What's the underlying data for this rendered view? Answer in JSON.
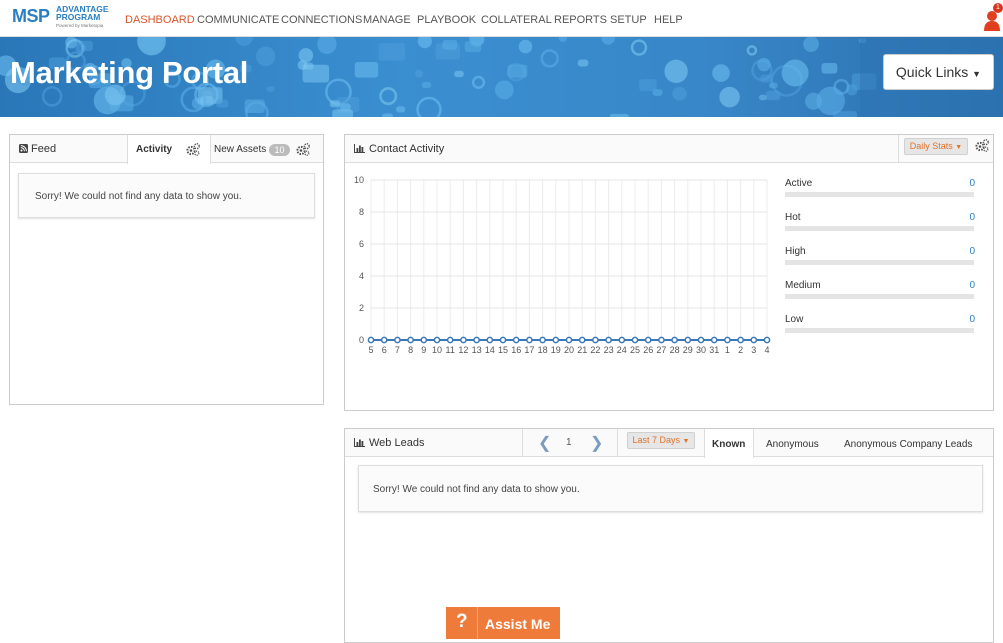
{
  "nav": {
    "logo": {
      "line1": "MSP",
      "line2": "ADVANTAGE",
      "line3": "PROGRAM",
      "powered": "Powered by Marketopia"
    },
    "links": [
      "DASHBOARD",
      "COMMUNICATE",
      "CONNECTIONS",
      "MANAGE",
      "PLAYBOOK",
      "COLLATERAL",
      "REPORTS",
      "SETUP",
      "HELP"
    ],
    "active": "DASHBOARD",
    "notification_count": "1"
  },
  "banner": {
    "title": "Marketing Portal",
    "quick_links": "Quick Links"
  },
  "feed": {
    "title": "Feed",
    "tabs": {
      "activity": "Activity",
      "new_assets": "New Assets",
      "new_assets_count": "10"
    },
    "empty_message": "Sorry! We could not find any data to show you."
  },
  "contact_activity": {
    "title": "Contact Activity",
    "range_label": "Daily Stats",
    "stats": [
      {
        "label": "Active",
        "value": "0"
      },
      {
        "label": "Hot",
        "value": "0"
      },
      {
        "label": "High",
        "value": "0"
      },
      {
        "label": "Medium",
        "value": "0"
      },
      {
        "label": "Low",
        "value": "0"
      }
    ]
  },
  "chart_data": {
    "type": "line",
    "categories": [
      "5",
      "6",
      "7",
      "8",
      "9",
      "10",
      "11",
      "12",
      "13",
      "14",
      "15",
      "16",
      "17",
      "18",
      "19",
      "20",
      "21",
      "22",
      "23",
      "24",
      "25",
      "26",
      "27",
      "28",
      "29",
      "30",
      "31",
      "1",
      "2",
      "3",
      "4"
    ],
    "values": [
      0,
      0,
      0,
      0,
      0,
      0,
      0,
      0,
      0,
      0,
      0,
      0,
      0,
      0,
      0,
      0,
      0,
      0,
      0,
      0,
      0,
      0,
      0,
      0,
      0,
      0,
      0,
      0,
      0,
      0,
      0
    ],
    "y_ticks": [
      "0",
      "2",
      "4",
      "6",
      "8",
      "10"
    ],
    "ylim": [
      0,
      10
    ],
    "grid": true,
    "color": "#3a78b8"
  },
  "web_leads": {
    "title": "Web Leads",
    "page": "1",
    "range_label": "Last 7 Days",
    "tabs": [
      "Known",
      "Anonymous",
      "Anonymous Company Leads"
    ],
    "empty_message": "Sorry! We could not find any data to show you."
  },
  "assist": {
    "label": "Assist Me",
    "icon": "?"
  }
}
